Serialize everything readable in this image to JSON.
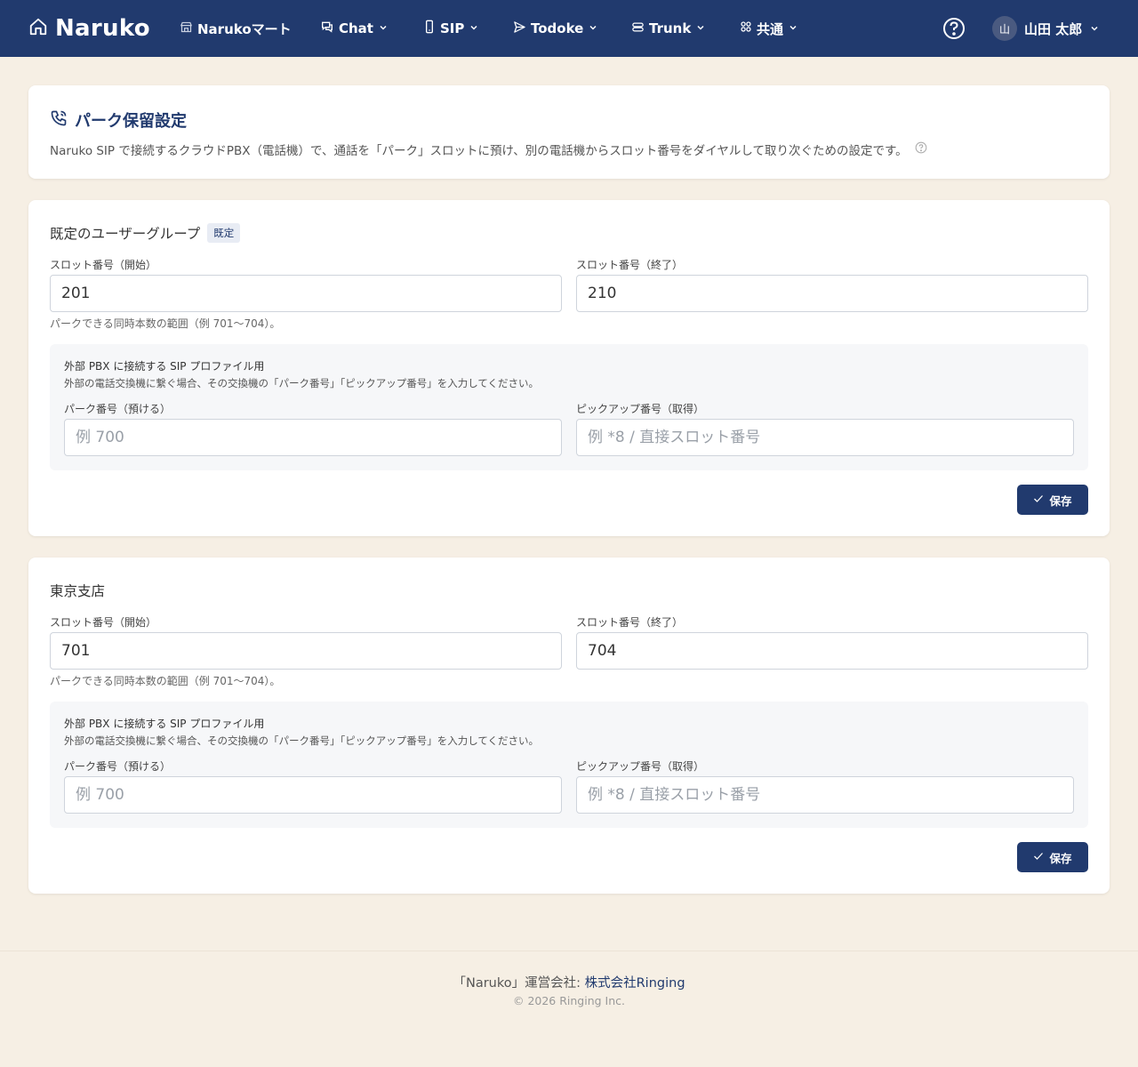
{
  "header": {
    "brand": "Naruko",
    "nav": [
      {
        "label": "Narukoマート",
        "icon": "store-icon"
      },
      {
        "label": "Chat",
        "icon": "chat-icon"
      },
      {
        "label": "SIP",
        "icon": "phone-device-icon"
      },
      {
        "label": "Todoke",
        "icon": "send-icon"
      },
      {
        "label": "Trunk",
        "icon": "server-icon"
      },
      {
        "label": "共通",
        "icon": "grid-icon"
      }
    ],
    "user": {
      "avatar_initial": "山",
      "name": "山田 太郎"
    }
  },
  "intro": {
    "title": "パーク保留設定",
    "description": "Naruko SIP で接続するクラウドPBX（電話機）で、通話を「パーク」スロットに預け、別の電話機からスロット番号をダイヤルして取り次ぐための設定です。"
  },
  "labels": {
    "slot_start": "スロット番号（開始）",
    "slot_end": "スロット番号（終了）",
    "hint": "パークできる同時本数の範囲（例 701〜704）。",
    "ext_title": "外部 PBX に接続する SIP プロファイル用",
    "ext_desc": "外部の電話交換機に繋ぐ場合、その交換機の「パーク番号」「ピックアップ番号」を入力してください。",
    "park_number": "パーク番号（預ける）",
    "pickup_number": "ピックアップ番号（取得）",
    "park_placeholder": "例 700",
    "pickup_placeholder": "例 *8 / 直接スロット番号",
    "save": "保存"
  },
  "groups": [
    {
      "name": "既定のユーザーグループ",
      "badge": "既定",
      "slot_start": "201",
      "slot_end": "210",
      "park_number": "",
      "pickup_number": ""
    },
    {
      "name": "東京支店",
      "badge": "",
      "slot_start": "701",
      "slot_end": "704",
      "park_number": "",
      "pickup_number": ""
    }
  ],
  "footer": {
    "prefix": "「Naruko」運営会社: ",
    "company": "株式会社Ringing",
    "copyright": "© 2026 Ringing Inc."
  },
  "colors": {
    "header_bg": "#213a6e",
    "page_bg": "#f6efe4",
    "accent": "#213a6e"
  }
}
